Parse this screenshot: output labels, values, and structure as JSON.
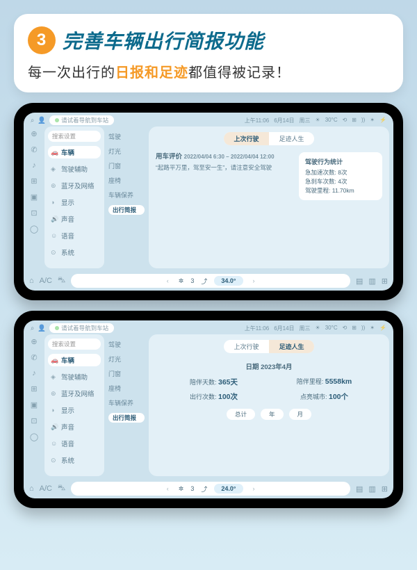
{
  "hero": {
    "step_num": "3",
    "title": "完善车辆出行简报功能",
    "sub_pre": "每一次出行的",
    "sub_hl": "日报和足迹",
    "sub_post": "都值得被记录！"
  },
  "status": {
    "location": "请试着导航到车站",
    "time": "上午11:06",
    "date": "6月14日",
    "weekday": "周三",
    "temp": "30°C",
    "icons": [
      "⟲",
      "⊞",
      "))",
      "✶",
      "⚡"
    ]
  },
  "nav1": {
    "search": "搜索设置",
    "items": [
      {
        "ico": "🚗",
        "label": "车辆"
      },
      {
        "ico": "◈",
        "label": "驾驶辅助"
      },
      {
        "ico": "⊚",
        "label": "蓝牙及网络"
      },
      {
        "ico": "◑",
        "label": "显示"
      },
      {
        "ico": "🔊",
        "label": "声音"
      },
      {
        "ico": "☺",
        "label": "语音"
      },
      {
        "ico": "⊙",
        "label": "系统"
      }
    ]
  },
  "nav2": {
    "items": [
      "驾驶",
      "灯光",
      "门窗",
      "座椅",
      "车辆保养"
    ],
    "active": "出行简报"
  },
  "screen1": {
    "tabs": [
      "上次行驶",
      "足迹人生"
    ],
    "rating_title": "用车评价",
    "rating_time": "2022/04/04 6:30 – 2022/04/04 12:00",
    "rating_quote": "“起路平万里，驾至安一生”，请注意安全驾驶",
    "stats_title": "驾驶行为统计",
    "stats": [
      {
        "k": "急加速次数:",
        "v": "8次"
      },
      {
        "k": "急刹车次数:",
        "v": "4次"
      },
      {
        "k": "驾驶里程:",
        "v": "11.70km"
      }
    ],
    "climate_temp": "34.0°"
  },
  "screen2": {
    "tabs": [
      "上次行驶",
      "足迹人生"
    ],
    "life_title": "日期 2023年4月",
    "life_stats": [
      {
        "k": "陪伴天数:",
        "v": "365天"
      },
      {
        "k": "陪伴里程:",
        "v": "5558km"
      },
      {
        "k": "出行次数:",
        "v": "100次"
      },
      {
        "k": "点亮城市:",
        "v": "100个"
      }
    ],
    "chips": [
      "总计",
      "年",
      "月"
    ],
    "climate_temp": "24.0°"
  },
  "dock": {
    "home": "⌂",
    "ac": "A/C",
    "car": "⛍",
    "fan": "✲",
    "fan_lvl": "3",
    "flow": "⤴",
    "defF": "▤",
    "defR": "▥",
    "menu": "⊞"
  }
}
